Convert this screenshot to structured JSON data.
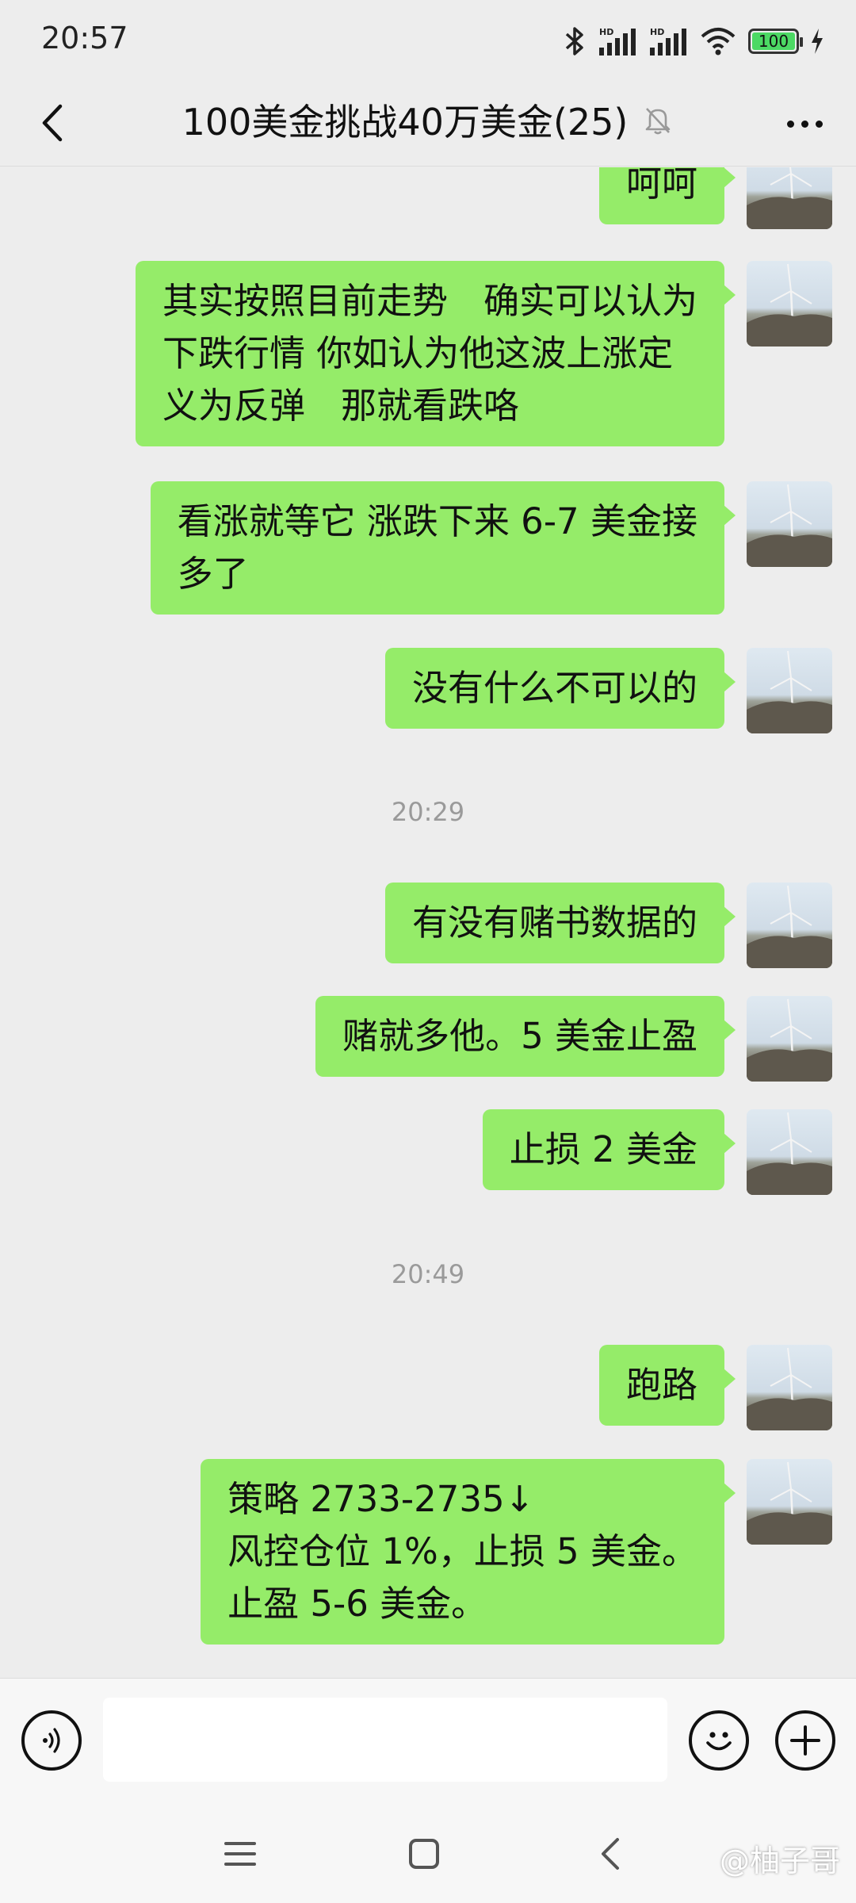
{
  "status_bar": {
    "time": "20:57",
    "battery": "100",
    "icons": [
      "bluetooth-icon",
      "hd-signal-icon",
      "hd-signal-icon",
      "wifi-icon",
      "battery-icon",
      "charging-icon"
    ]
  },
  "header": {
    "title": "100美金挑战40万美金(25)",
    "muted_icon": "bell-off-icon"
  },
  "messages": [
    {
      "lines": [
        "呵呵"
      ]
    },
    {
      "lines": [
        "其实按照目前走势　确实可以认为",
        "下跌行情  你如认为他这波上涨定",
        "义为反弹　那就看跌咯"
      ]
    },
    {
      "lines": [
        "看涨就等它  涨跌下来 6-7 美金接",
        "多了"
      ]
    },
    {
      "lines": [
        "没有什么不可以的"
      ]
    },
    {
      "lines": [
        "有没有赌书数据的"
      ]
    },
    {
      "lines": [
        "赌就多他。5 美金止盈"
      ]
    },
    {
      "lines": [
        "止损 2 美金"
      ]
    },
    {
      "lines": [
        "跑路"
      ]
    },
    {
      "lines": [
        "策略 2733-2735↓",
        "风控仓位 1%，止损 5 美金。",
        "止盈 5-6 美金。"
      ]
    }
  ],
  "timestamps": [
    "20:29",
    "20:49"
  ],
  "input_bar": {
    "placeholder": "",
    "icons": [
      "voice-icon",
      "emoji-icon",
      "plus-icon"
    ]
  },
  "nav_bar": {
    "icons": [
      "menu-icon",
      "home-icon",
      "back-icon"
    ]
  },
  "watermark": "@柚子哥",
  "colors": {
    "background": "#ededed",
    "bubble": "#95ec69",
    "timestamp": "#9a9a9a",
    "input_bar": "#f7f7f7"
  }
}
